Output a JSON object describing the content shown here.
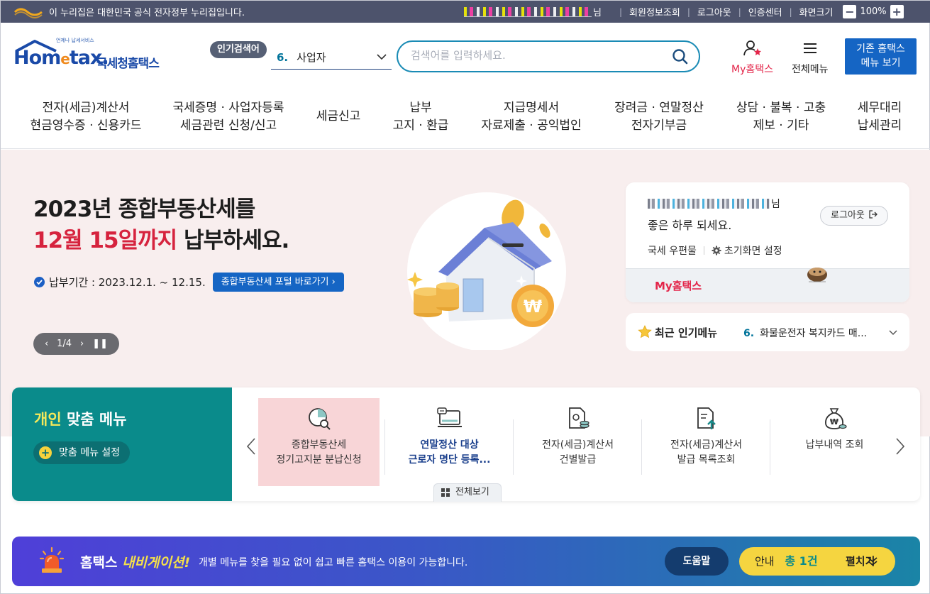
{
  "topbar": {
    "gov_notice": "이 누리집은 대한민국 공식 전자정부 누리집입니다.",
    "user_suffix": "님",
    "links": [
      "회원정보조회",
      "로그아웃",
      "인증센터",
      "화면크기"
    ],
    "zoom_level": "100%",
    "zoom_out": "−",
    "zoom_in": "+"
  },
  "header": {
    "logo_tagline": "언제나 납세서비스",
    "logo_text": "Home tax.",
    "logo_kor": "국세청홈택스",
    "popular_tag": "인기검색어",
    "popular_num": "6.",
    "popular_value": "사업자",
    "search_placeholder": "검색어를 입력하세요.",
    "my_hometax": "My홈택스",
    "all_menu": "전체메뉴",
    "old_menu_line1": "기존 홈택스",
    "old_menu_line2": "메뉴 보기"
  },
  "gnb": [
    {
      "line1": "전자(세금)계산서",
      "line2": "현금영수증 · 신용카드"
    },
    {
      "line1": "국세증명 · 사업자등록",
      "line2": "세금관련 신청/신고"
    },
    {
      "line1": "세금신고",
      "line2": ""
    },
    {
      "line1": "납부",
      "line2": "고지 · 환급"
    },
    {
      "line1": "지급명세서",
      "line2": "자료제출 · 공익법인"
    },
    {
      "line1": "장려금 · 연말정산",
      "line2": "전자기부금"
    },
    {
      "line1": "상담 · 불복 · 고충",
      "line2": "제보 · 기타"
    },
    {
      "line1": "세무대리",
      "line2": "납세관리"
    }
  ],
  "hero": {
    "title_line1": "2023년 종합부동산세를",
    "title_red": "12월 15일까지",
    "title_rest": " 납부하세요.",
    "period": "납부기간 : 2023.12.1. ~ 12.15.",
    "portal_button": "종합부동산세 포털 바로가기",
    "pager": "1/4"
  },
  "login_card": {
    "name_suffix": "님",
    "greeting": "좋은 하루 되세요.",
    "logout": "로그아웃",
    "mailbox": "국세 우편물",
    "home_setting": "초기화면 설정",
    "my_hometax": "My홈택스"
  },
  "recent": {
    "title": "최근 인기메뉴",
    "num": "6.",
    "item": "화물운전자 복지카드 매..."
  },
  "custom_menu": {
    "title_badge": "개인",
    "title": "맞춤 메뉴",
    "setting": "맞춤 메뉴 설정",
    "view_all": "전체보기",
    "items": [
      {
        "line1": "종합부동산세",
        "line2": "정기고지분 분납신청",
        "icon": "pie-chart-search-icon"
      },
      {
        "line1": "연말정산 대상",
        "line2": "근로자 명단 등록...",
        "icon": "laptop-chat-icon"
      },
      {
        "line1": "전자(세금)계산서",
        "line2": "건별발급",
        "icon": "document-coins-icon"
      },
      {
        "line1": "전자(세금)계산서",
        "line2": "발급 목록조회",
        "icon": "document-upload-icon"
      },
      {
        "line1": "납부내역 조회",
        "line2": "",
        "icon": "money-bag-icon"
      }
    ]
  },
  "navigation": {
    "title_prefix": "홈택스",
    "title_hl": "내비게이션!",
    "desc": "개별 메뉴를 찾을 필요 없이 쉽고 빠른 홈택스 이용이 가능합니다.",
    "help": "도움말",
    "guide": "안내",
    "count": "총 1건",
    "expand": "펼치기"
  },
  "colors": {
    "brand": "#1565c4",
    "accent_red": "#d6233e",
    "teal": "#0a8b8b",
    "topbar": "#4d536c"
  }
}
